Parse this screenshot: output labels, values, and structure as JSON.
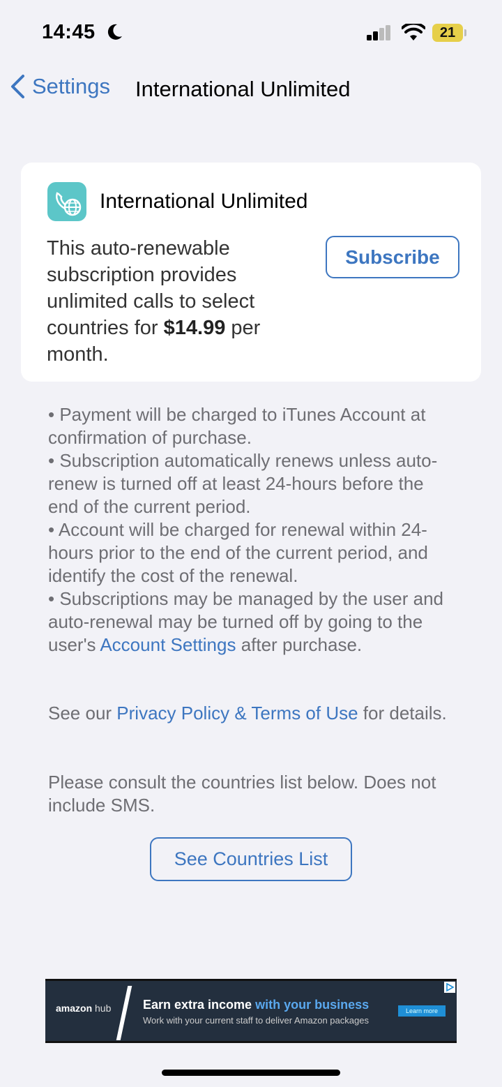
{
  "status_bar": {
    "time": "14:45",
    "battery_level": "21",
    "icons": [
      "moon-icon",
      "cellular-signal-icon",
      "wifi-icon",
      "battery-icon"
    ]
  },
  "nav": {
    "back_label": "Settings",
    "title": "International Unlimited"
  },
  "card": {
    "app_name": "International Unlimited",
    "description_pre": "This auto-renewable subscription provides unlimited calls to select countries for ",
    "price": "$14.99",
    "description_post": " per month.",
    "subscribe_label": "Subscribe"
  },
  "terms": {
    "bullet1": "• Payment will be charged to iTunes Account at confirmation of purchase.",
    "bullet2": "• Subscription automatically renews unless auto-renew is turned off at least 24-hours before the end of the current period.",
    "bullet3": "• Account will be charged for renewal within 24-hours prior to the end of the current period, and identify the cost of the renewal.",
    "bullet4_pre": "• Subscriptions may be managed by the user and auto-renewal may be turned off by going to the user's ",
    "bullet4_link": "Account Settings",
    "bullet4_post": " after purchase."
  },
  "privacy": {
    "pre": "See our ",
    "link": "Privacy Policy & Terms of Use",
    "post": " for details."
  },
  "consult_text": "Please consult the countries list below. Does not include SMS.",
  "countries_button_label": "See Countries List",
  "ad": {
    "logo_amazon": "amazon",
    "logo_hub": "hub",
    "headline_pre": "Earn extra income ",
    "headline_highlight": "with your business",
    "subline": "Work with your current staff to deliver Amazon packages",
    "cta": "Learn more"
  },
  "colors": {
    "accent": "#3d76c0",
    "background": "#f2f2f7",
    "card": "#ffffff",
    "secondary_text": "#6e6e73",
    "battery": "#e6cf4a"
  }
}
